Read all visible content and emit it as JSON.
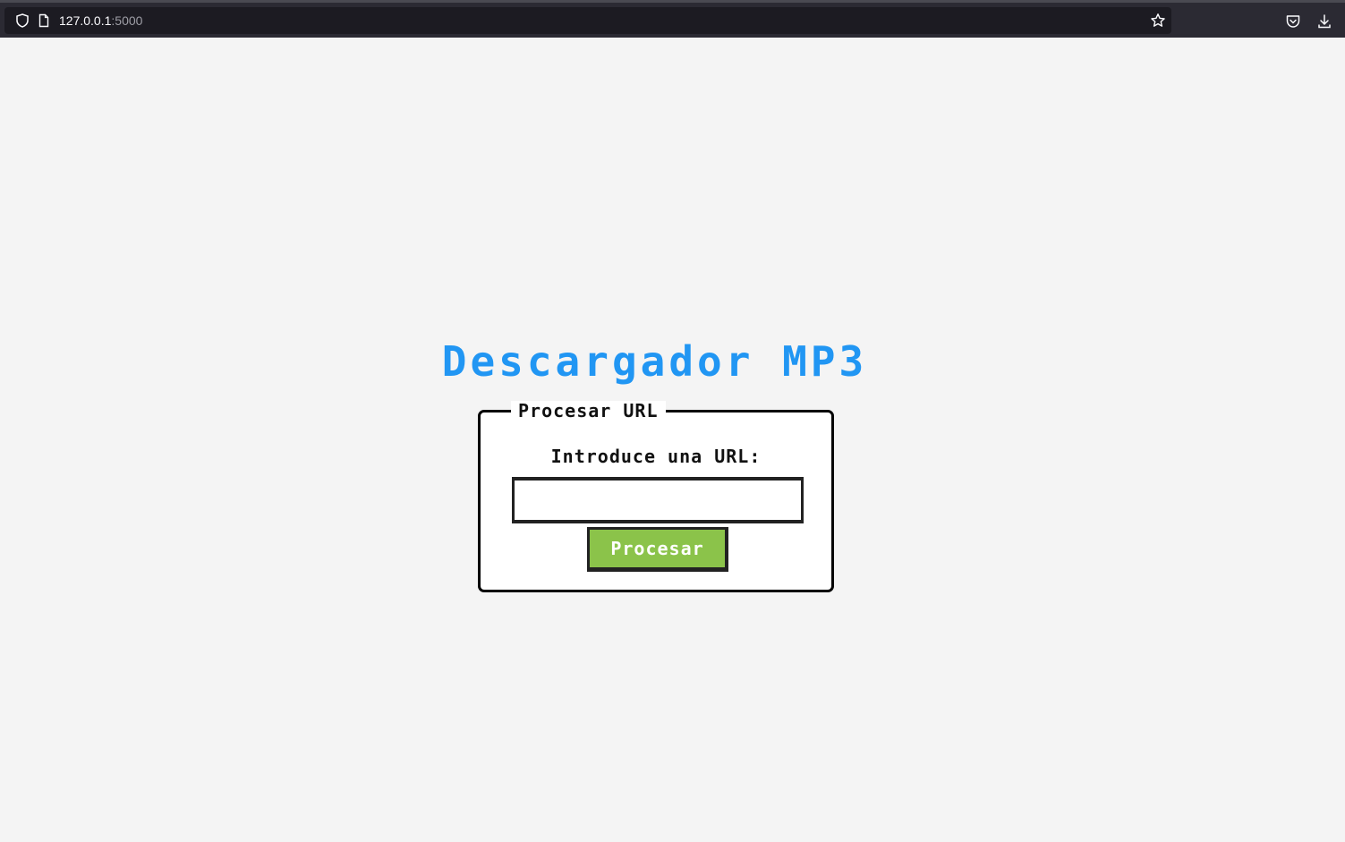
{
  "browser": {
    "url_host": "127.0.0.1",
    "url_port": ":5000",
    "icons": [
      "shield-icon",
      "page-icon",
      "star-icon",
      "pocket-icon",
      "download-icon"
    ]
  },
  "page": {
    "title": "Descargador MP3",
    "form": {
      "legend": "Procesar URL",
      "prompt": "Introduce una URL:",
      "input_value": "",
      "submit_label": "Procesar"
    }
  },
  "colors": {
    "title": "#2196f3",
    "button": "#8bc34a",
    "background": "#f4f4f4"
  }
}
